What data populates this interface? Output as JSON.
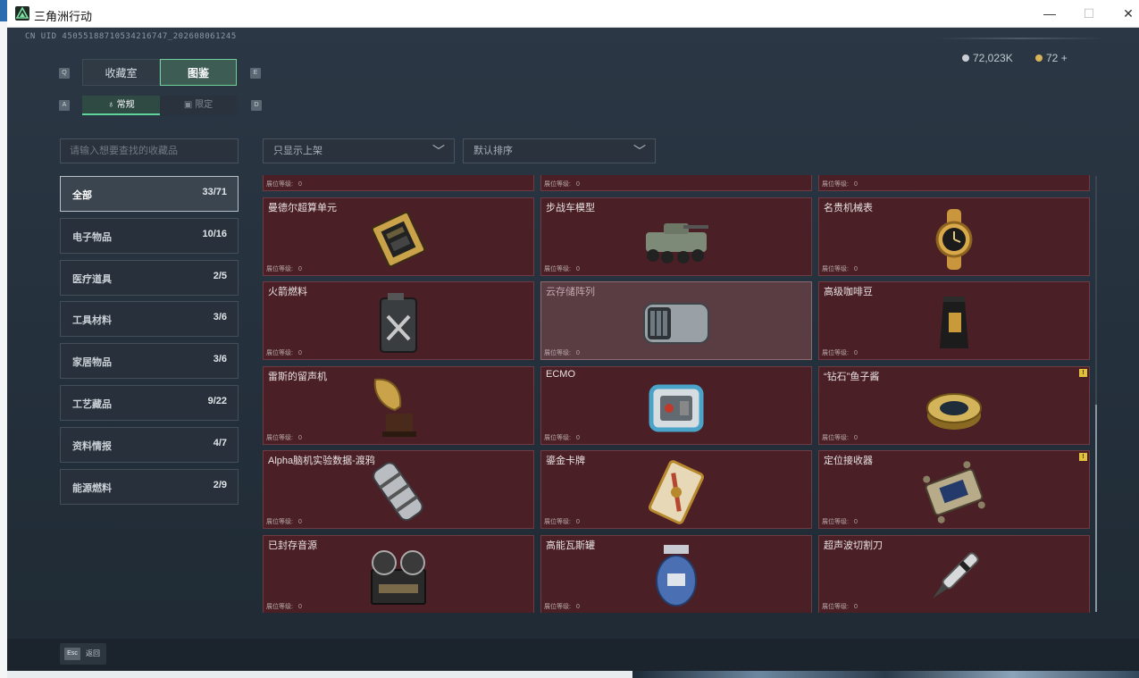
{
  "window": {
    "title": "三角洲行动",
    "minimize": "—",
    "maximize": "☐",
    "close": "✕"
  },
  "header": {
    "uid": "CN UID 45055188710534216747_202608061245",
    "currency_silver": "72,023K",
    "currency_gold": "72",
    "add": "+"
  },
  "tabs": {
    "key_left": "Q",
    "key_right": "E",
    "items": [
      {
        "label": "收藏室"
      },
      {
        "label": "图鉴"
      }
    ]
  },
  "subtabs": {
    "key_left": "A",
    "key_right": "D",
    "items": [
      {
        "label": "常规",
        "icon": "lock-icon"
      },
      {
        "label": "限定",
        "icon": "box-icon"
      }
    ]
  },
  "search": {
    "placeholder": "请输入想要查找的收藏品"
  },
  "filters": {
    "filter1": "只显示上架",
    "filter2": "默认排序"
  },
  "categories": [
    {
      "name": "全部",
      "count": "33/71",
      "selected": true
    },
    {
      "name": "电子物品",
      "count": "10/16"
    },
    {
      "name": "医疗道具",
      "count": "2/5"
    },
    {
      "name": "工具材料",
      "count": "3/6"
    },
    {
      "name": "家居物品",
      "count": "3/6"
    },
    {
      "name": "工艺藏品",
      "count": "9/22"
    },
    {
      "name": "资料情报",
      "count": "4/7"
    },
    {
      "name": "能源燃料",
      "count": "2/9"
    }
  ],
  "level_label": "展位等级:",
  "items": [
    {
      "name": "",
      "level": "0",
      "icon": "partial-item"
    },
    {
      "name": "",
      "level": "0",
      "icon": "partial-item"
    },
    {
      "name": "",
      "level": "0",
      "icon": "partial-item"
    },
    {
      "name": "曼德尔超算单元",
      "level": "0",
      "icon": "supercomputer-chip-icon"
    },
    {
      "name": "步战车模型",
      "level": "0",
      "icon": "ifv-model-icon"
    },
    {
      "name": "名贵机械表",
      "level": "0",
      "icon": "gold-watch-icon"
    },
    {
      "name": "火箭燃料",
      "level": "0",
      "icon": "fuel-canister-icon"
    },
    {
      "name": "云存储阵列",
      "level": "0",
      "icon": "storage-array-icon",
      "highlight": true
    },
    {
      "name": "高级咖啡豆",
      "level": "0",
      "icon": "coffee-bag-icon"
    },
    {
      "name": "雷斯的留声机",
      "level": "0",
      "icon": "gramophone-icon"
    },
    {
      "name": "ECMO",
      "level": "0",
      "icon": "ecmo-machine-icon"
    },
    {
      "name": "“钻石”鱼子酱",
      "level": "0",
      "icon": "caviar-tin-icon",
      "warn": "!"
    },
    {
      "name": "Alpha脑机实验数据-渡鸦",
      "level": "0",
      "icon": "data-cylinder-icon"
    },
    {
      "name": "鎏金卡牌",
      "level": "0",
      "icon": "gilded-card-icon"
    },
    {
      "name": "定位接收器",
      "level": "0",
      "icon": "receiver-icon",
      "warn": "!"
    },
    {
      "name": "已封存音源",
      "level": "0",
      "icon": "reel-recorder-icon"
    },
    {
      "name": "高能瓦斯罐",
      "level": "0",
      "icon": "gas-canister-icon"
    },
    {
      "name": "超声波切割刀",
      "level": "0",
      "icon": "ultrasonic-knife-icon"
    }
  ],
  "footer": {
    "key": "Esc",
    "label": "返回"
  },
  "colors": {
    "accent": "#5fd39a",
    "card_bg": "#4a1f25",
    "card_highlight": "#5a3c43",
    "warn": "#e3c23b"
  }
}
